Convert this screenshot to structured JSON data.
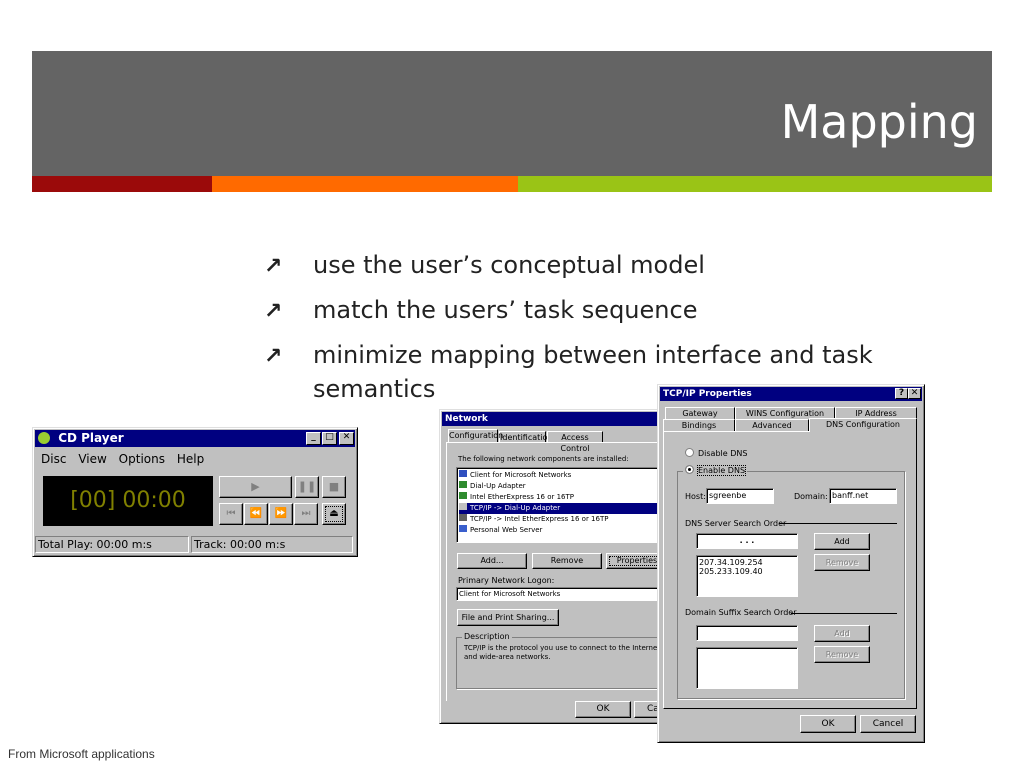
{
  "slide": {
    "title": "Mapping",
    "stripe_colors": [
      "#9b0a0a",
      "#ff6a00",
      "#9ac416"
    ],
    "header_color": "#646464",
    "bullets": [
      "use the user’s conceptual model",
      "match the users’ task sequence",
      "minimize mapping between interface and task semantics"
    ],
    "credit": "From Microsoft applications"
  },
  "cd_player": {
    "title": "CD Player",
    "menu": [
      "Disc",
      "View",
      "Options",
      "Help"
    ],
    "display": "[00] 00:00",
    "controls": [
      "play",
      "pause",
      "stop",
      "prev-track",
      "rewind",
      "fast-forward",
      "next-track",
      "eject"
    ],
    "status_total": "Total Play: 00:00 m:s",
    "status_track": "Track: 00:00 m:s"
  },
  "network": {
    "title": "Network",
    "tabs": [
      "Configuration",
      "Identification",
      "Access Control"
    ],
    "components_label": "The following network components are installed:",
    "components": [
      "Client for Microsoft Networks",
      "Dial-Up Adapter",
      "Intel EtherExpress 16 or 16TP",
      "TCP/IP -> Dial-Up Adapter",
      "TCP/IP -> Intel EtherExpress 16 or 16TP",
      "Personal Web Server"
    ],
    "selected_component": "TCP/IP -> Dial-Up Adapter",
    "add_button": "Add...",
    "remove_button": "Remove",
    "properties_button": "Properties",
    "logon_label": "Primary Network Logon:",
    "logon_value": "Client for Microsoft Networks",
    "file_print_button": "File and Print Sharing...",
    "description_label": "Description",
    "description_text": "TCP/IP is the protocol you use to connect to the Internet and wide-area networks.",
    "ok_button": "OK",
    "cancel_button": "Ca"
  },
  "tcpip": {
    "title": "TCP/IP Properties",
    "tabs_row1": [
      "Gateway",
      "WINS Configuration",
      "IP Address"
    ],
    "tabs_row2": [
      "Bindings",
      "Advanced",
      "DNS Configuration"
    ],
    "disable_dns": "Disable DNS",
    "enable_dns": "Enable DNS",
    "host_label": "Host:",
    "host_value": "sgreenbe",
    "domain_label": "Domain:",
    "domain_value": "banff.net",
    "dns_order_label": "DNS Server Search Order",
    "ip_placeholder": ".   .   .",
    "dns_servers": [
      "207.34.109.254",
      "205.233.109.40"
    ],
    "add_button": "Add",
    "remove_button": "Remove",
    "suffix_label": "Domain Suffix Search Order",
    "suffix_add": "Add",
    "suffix_remove": "Remove",
    "ok_button": "OK",
    "cancel_button": "Cancel"
  }
}
